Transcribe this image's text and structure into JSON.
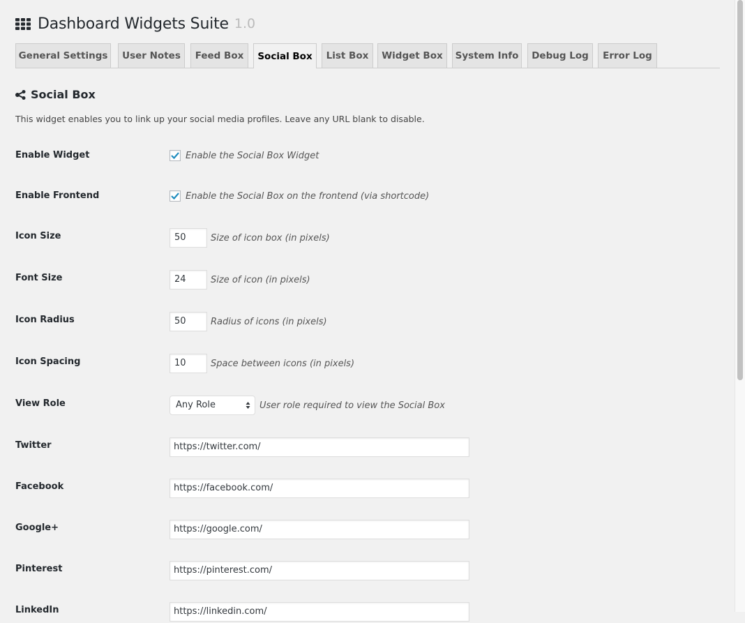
{
  "header": {
    "icon": "grid-icon",
    "title": "Dashboard Widgets Suite",
    "version": "1.0"
  },
  "tabs": [
    {
      "label": "General Settings",
      "active": false
    },
    {
      "label": "User Notes",
      "active": false
    },
    {
      "label": "Feed Box",
      "active": false
    },
    {
      "label": "Social Box",
      "active": true
    },
    {
      "label": "List Box",
      "active": false
    },
    {
      "label": "Widget Box",
      "active": false
    },
    {
      "label": "System Info",
      "active": false
    },
    {
      "label": "Debug Log",
      "active": false
    },
    {
      "label": "Error Log",
      "active": false
    }
  ],
  "section": {
    "icon": "share-icon",
    "title": "Social Box",
    "description": "This widget enables you to link up your social media profiles. Leave any URL blank to disable."
  },
  "settings": {
    "enable_widget": {
      "label": "Enable Widget",
      "checked": true,
      "hint": "Enable the Social Box Widget"
    },
    "enable_frontend": {
      "label": "Enable Frontend",
      "checked": true,
      "hint": "Enable the Social Box on the frontend (via shortcode)"
    },
    "icon_size": {
      "label": "Icon Size",
      "value": "50",
      "hint": "Size of icon box (in pixels)"
    },
    "font_size": {
      "label": "Font Size",
      "value": "24",
      "hint": "Size of icon (in pixels)"
    },
    "icon_radius": {
      "label": "Icon Radius",
      "value": "50",
      "hint": "Radius of icons (in pixels)"
    },
    "icon_spacing": {
      "label": "Icon Spacing",
      "value": "10",
      "hint": "Space between icons (in pixels)"
    },
    "view_role": {
      "label": "View Role",
      "value": "Any Role",
      "hint": "User role required to view the Social Box"
    },
    "twitter": {
      "label": "Twitter",
      "value": "https://twitter.com/"
    },
    "facebook": {
      "label": "Facebook",
      "value": "https://facebook.com/"
    },
    "google": {
      "label": "Google+",
      "value": "https://google.com/"
    },
    "pinterest": {
      "label": "Pinterest",
      "value": "https://pinterest.com/"
    },
    "linkedin": {
      "label": "LinkedIn",
      "value": "https://linkedin.com/"
    }
  },
  "colors": {
    "checkmark": "#1e8cbe",
    "background": "#f1f1f1",
    "version_text": "#bbbbbb"
  }
}
